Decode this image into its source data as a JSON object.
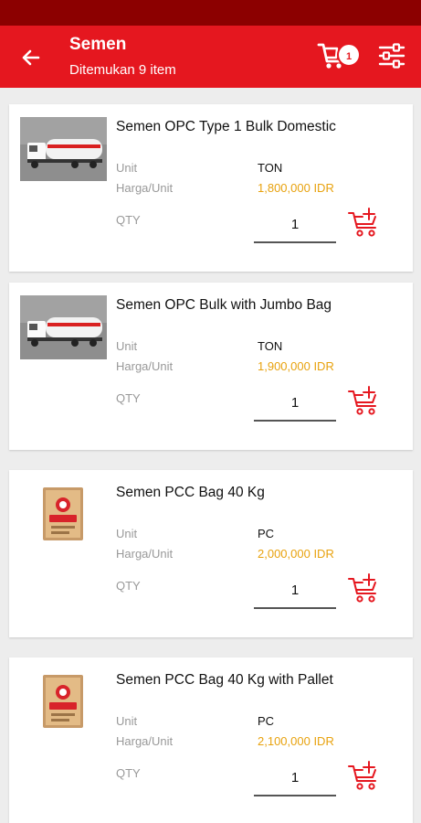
{
  "header": {
    "title": "Semen",
    "subtitle": "Ditemukan 9 item",
    "cart_count": "1"
  },
  "labels": {
    "unit": "Unit",
    "price": "Harga/Unit",
    "qty": "QTY"
  },
  "products": [
    {
      "name": "Semen OPC Type 1 Bulk Domestic",
      "unit": "TON",
      "price": "1,800,000 IDR",
      "qty": "1",
      "image": "tanker-truck"
    },
    {
      "name": "Semen OPC Bulk with Jumbo Bag",
      "unit": "TON",
      "price": "1,900,000 IDR",
      "qty": "1",
      "image": "tanker-truck"
    },
    {
      "name": "Semen PCC Bag 40 Kg",
      "unit": "PC",
      "price": "2,000,000 IDR",
      "qty": "1",
      "image": "cement-bag"
    },
    {
      "name": "Semen PCC Bag 40 Kg with Pallet",
      "unit": "PC",
      "price": "2,100,000 IDR",
      "qty": "1",
      "image": "cement-bag"
    }
  ],
  "colors": {
    "primary": "#e5171f",
    "statusbar": "#8c0000",
    "price": "#e8a20e"
  }
}
